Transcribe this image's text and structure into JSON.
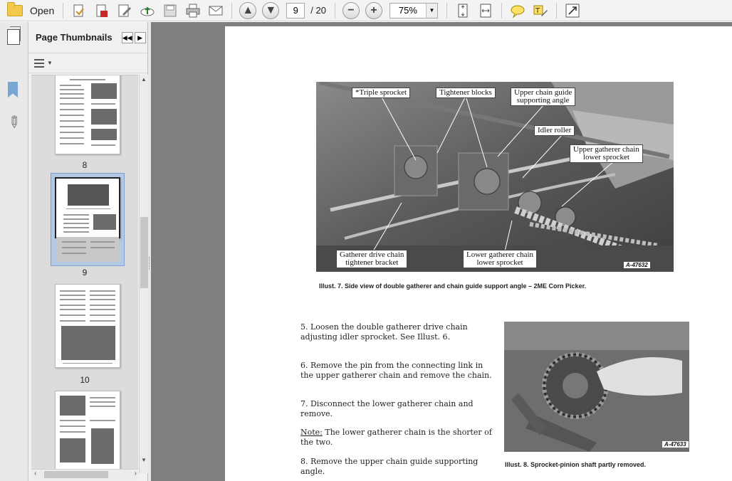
{
  "toolbar": {
    "open_label": "Open",
    "current_page": "9",
    "total_pages": "/ 20",
    "zoom": "75%",
    "zoom_out_symbol": "−",
    "zoom_in_symbol": "+"
  },
  "panel": {
    "title": "Page Thumbnails",
    "thumbnails": [
      {
        "label": "8"
      },
      {
        "label": "9"
      },
      {
        "label": "10"
      }
    ]
  },
  "document": {
    "illus7": {
      "callouts": {
        "triple": "*Triple sprocket",
        "tightener": "Tightener blocks",
        "upper_guide": "Upper chain guide\nsupporting angle",
        "idler": "Idler roller",
        "upper_gatherer": "Upper gatherer chain\nlower sprocket",
        "drive_bracket": "Gatherer drive chain\ntightener bracket",
        "lower_gatherer": "Lower gatherer chain\nlower sprocket"
      },
      "tag": "A-47632",
      "caption": "Illust. 7.  Side view of double gatherer and chain guide support angle – 2ME Corn Picker."
    },
    "illus8": {
      "tag": "A-47633",
      "caption": "Illust. 8.  Sprocket-pinion shaft partly removed."
    },
    "steps": {
      "s5": "5. Loosen the double gatherer drive chain adjusting idler sprocket.  See Illust. 6.",
      "s6": "6. Remove the pin from the connecting link in the upper gatherer chain and remove the chain.",
      "s7": "7. Disconnect the lower gatherer chain and remove.",
      "note_label": "Note:",
      "note_text": " The lower gatherer chain is the shorter of the two.",
      "s8": "8. Remove the upper chain guide supporting angle."
    }
  }
}
